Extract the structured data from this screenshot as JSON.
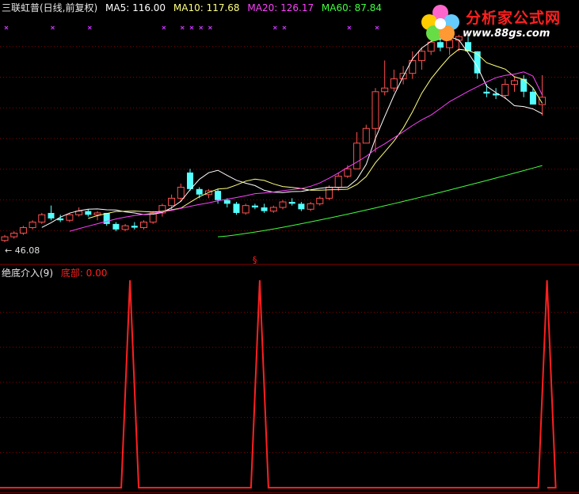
{
  "header": {
    "title": "三联虹普(日线,前复权)",
    "ma5": "MA5: 116.00",
    "ma10": "MA10: 117.68",
    "ma20": "MA20: 126.17",
    "ma60": "MA60: 87.84"
  },
  "indicator": {
    "name": "绝底介入(9)",
    "value": "底部: 0.00"
  },
  "low_label": "← 46.08",
  "watermark": {
    "title": "分析家公式网",
    "url": "www.88gs.com"
  },
  "colors": {
    "up": "#ff5050",
    "down": "#54ffff",
    "ma5": "#ffffff",
    "ma10": "#ffff80",
    "ma20": "#ff40ff",
    "ma60": "#40ff40",
    "signal": "#ff2020",
    "marker": "#cc33ff",
    "grid": "#8b0000"
  },
  "chart_data": [
    {
      "type": "candlestick",
      "title": "三联虹普(日线,前复权)",
      "ylim": [
        40,
        165
      ],
      "low_price": 46.08,
      "series": [
        {
          "name": "MA5",
          "values": [
            null,
            null,
            null,
            null,
            54.1,
            56.7,
            59.7,
            61.9,
            63.2,
            64.0,
            64.2,
            63.7,
            63.6,
            62.6,
            62.0,
            61.1,
            61.3,
            62.3,
            64.8,
            68.3,
            74.6,
            80.3,
            83.9,
            85.2,
            82.4,
            79.8,
            78.2,
            76.9,
            74.3,
            73.3,
            73.1,
            73.6,
            73.7,
            74.6,
            75.4,
            76.0,
            75.8,
            76.1,
            80.3,
            88.4,
            102.6,
            114.5,
            126.0,
            136.3,
            145.9,
            151.8,
            155.4,
            156.6,
            157.9,
            156.2,
            149.2,
            141.6,
            131.0,
            127.5,
            124.6,
            120.4,
            119.9,
            118.6,
            116.0
          ]
        },
        {
          "name": "MA10",
          "values": [
            null,
            null,
            null,
            null,
            null,
            null,
            null,
            null,
            null,
            59.0,
            60.5,
            61.7,
            62.8,
            62.9,
            63.0,
            62.7,
            62.5,
            62.9,
            63.7,
            64.6,
            67.8,
            70.8,
            73.1,
            75.0,
            75.4,
            77.2,
            79.3,
            80.4,
            79.7,
            77.8,
            76.4,
            75.9,
            75.3,
            74.4,
            74.4,
            74.6,
            74.7,
            74.9,
            77.5,
            81.8,
            89.3,
            95.2,
            101.1,
            108.2,
            117.1,
            127.2,
            135.0,
            141.3,
            147.1,
            151.1,
            150.5,
            148.5,
            143.8,
            142.0,
            140.3,
            136.1,
            134.6,
            130.1,
            121.7
          ]
        },
        {
          "name": "MA20",
          "values": [
            null,
            null,
            null,
            null,
            null,
            null,
            null,
            52.0,
            53.4,
            54.8,
            56.1,
            57.4,
            58.7,
            59.7,
            60.6,
            61.2,
            61.8,
            62.6,
            63.4,
            64.5,
            65.6,
            66.6,
            67.5,
            68.6,
            69.5,
            70.4,
            71.4,
            72.5,
            72.9,
            73.4,
            74.1,
            74.7,
            75.3,
            76.5,
            78.3,
            80.9,
            83.7,
            86.8,
            89.7,
            92.8,
            96.7,
            99.6,
            102.9,
            106.2,
            109.6,
            112.7,
            115.3,
            118.9,
            122.6,
            125.4,
            128.2,
            130.7,
            133.3,
            135.6,
            136.9,
            137.6,
            138.8,
            136.5,
            126.2
          ]
        },
        {
          "name": "MA60",
          "values": [
            null,
            null,
            null,
            null,
            null,
            null,
            null,
            null,
            null,
            null,
            null,
            null,
            null,
            null,
            null,
            null,
            null,
            null,
            null,
            null,
            null,
            null,
            null,
            null,
            null,
            null,
            null,
            null,
            null,
            null,
            null,
            null,
            null,
            null,
            null,
            null,
            null,
            null,
            null,
            null,
            null,
            null,
            null,
            null,
            null,
            null,
            null,
            null,
            null,
            null,
            null,
            null,
            null,
            null,
            null,
            null,
            null,
            null,
            87.8
          ]
        },
        {
          "name": "candles",
          "ohlc": [
            [
              47,
              50,
              46.08,
              49
            ],
            [
              49,
              52,
              48,
              51
            ],
            [
              51,
              55,
              50,
              54
            ],
            [
              54,
              58,
              53,
              57
            ],
            [
              57,
              62,
              56,
              61
            ],
            [
              62,
              66,
              58,
              59
            ],
            [
              59,
              61,
              57,
              58
            ],
            [
              58,
              62,
              57,
              61
            ],
            [
              61,
              65,
              60,
              63
            ],
            [
              63,
              64,
              60,
              61
            ],
            [
              61,
              63,
              58,
              62
            ],
            [
              62,
              62,
              55,
              56
            ],
            [
              56,
              57,
              52,
              53
            ],
            [
              53,
              56,
              52,
              55
            ],
            [
              55,
              57,
              53,
              54
            ],
            [
              54,
              58,
              53,
              57
            ],
            [
              57,
              63,
              56,
              62
            ],
            [
              62,
              67,
              60,
              66
            ],
            [
              66,
              72,
              64,
              70
            ],
            [
              70,
              78,
              68,
              76
            ],
            [
              84,
              86,
              74,
              75
            ],
            [
              75,
              76,
              70,
              72
            ],
            [
              72,
              75,
              70,
              74
            ],
            [
              74,
              75,
              67,
              69
            ],
            [
              69,
              70,
              65,
              67
            ],
            [
              67,
              68,
              61,
              62
            ],
            [
              62,
              67,
              61,
              66
            ],
            [
              66,
              67,
              64,
              65
            ],
            [
              65,
              67,
              62,
              63
            ],
            [
              63,
              66,
              62,
              65
            ],
            [
              65,
              69,
              64,
              68
            ],
            [
              68,
              70,
              66,
              67
            ],
            [
              67,
              68,
              63,
              64
            ],
            [
              64,
              68,
              63,
              67
            ],
            [
              67,
              71,
              66,
              70
            ],
            [
              70,
              77,
              69,
              76
            ],
            [
              76,
              84,
              74,
              82
            ],
            [
              82,
              88,
              81,
              86
            ],
            [
              86,
              106,
              86,
              100
            ],
            [
              100,
              110,
              100,
              108
            ],
            [
              108,
              130,
              95,
              128
            ],
            [
              128,
              145,
              126,
              130
            ],
            [
              130,
              140,
              128,
              135
            ],
            [
              135,
              142,
              132,
              138
            ],
            [
              138,
              150,
              135,
              145
            ],
            [
              145,
              152,
              140,
              150
            ],
            [
              150,
              158,
              148,
              155
            ],
            [
              155,
              158,
              150,
              152
            ],
            [
              152,
              160,
              148,
              156
            ],
            [
              156,
              159,
              150,
              158
            ],
            [
              155,
              158,
              150,
              150
            ],
            [
              150,
              150,
              135,
              138
            ],
            [
              128,
              132,
              125,
              127
            ],
            [
              127,
              130,
              124,
              126
            ],
            [
              126,
              135,
              124,
              132
            ],
            [
              132,
              136,
              128,
              134
            ],
            [
              135,
              137,
              125,
              128
            ],
            [
              128,
              130,
              122,
              121
            ],
            [
              121,
              137,
              115,
              125
            ]
          ]
        }
      ]
    },
    {
      "type": "line",
      "title": "绝底介入(9)",
      "ylim": [
        0,
        1
      ],
      "series": [
        {
          "name": "底部",
          "signal_indices": [
            13,
            27,
            58
          ]
        }
      ]
    }
  ]
}
